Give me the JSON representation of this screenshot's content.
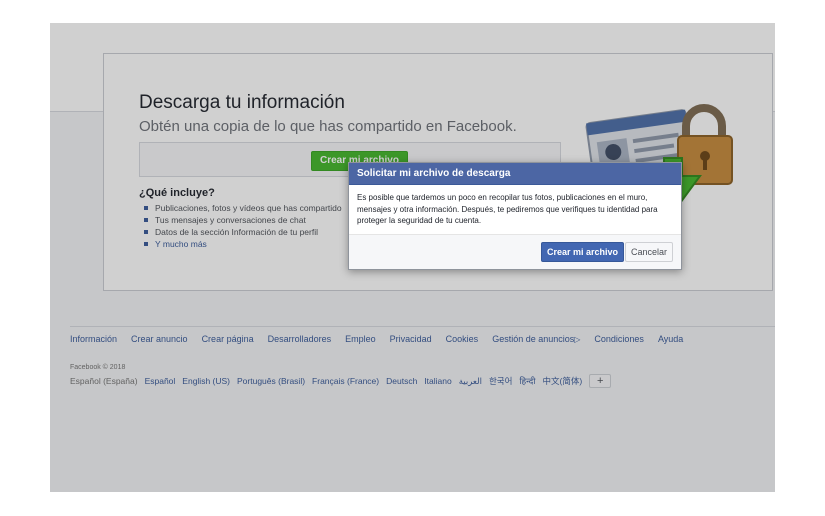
{
  "card": {
    "title": "Descarga tu información",
    "subtitle": "Obtén una copia de lo que has compartido en Facebook.",
    "create_button": "Crear mi archivo",
    "includes_heading": "¿Qué incluye?",
    "includes_items": [
      "Publicaciones, fotos y vídeos que has compartido",
      "Tus mensajes y conversaciones de chat",
      "Datos de la sección Información de tu perfil",
      "Y mucho más"
    ]
  },
  "illustration": {
    "icon": "profile-card-lock-download-icon",
    "colors": {
      "lock": "#c68a3a",
      "arrow": "#42b72a",
      "card": "#4b6ea8"
    }
  },
  "footer": {
    "links": [
      "Información",
      "Crear anuncio",
      "Crear página",
      "Desarrolladores",
      "Empleo",
      "Privacidad",
      "Cookies",
      "Gestión de anuncios",
      "Condiciones",
      "Ayuda"
    ],
    "copyright": "Facebook © 2018",
    "current_language": "Español (España)",
    "languages": [
      "Español",
      "English (US)",
      "Português (Brasil)",
      "Français (France)",
      "Deutsch",
      "Italiano",
      "العربية",
      "한국어",
      "हिन्दी",
      "中文(简体)"
    ],
    "more_languages": "+"
  },
  "modal": {
    "title": "Solicitar mi archivo de descarga",
    "body": "Es posible que tardemos un poco en recopilar tus fotos, publicaciones en el muro, mensajes y otra información. Después, te pediremos que verifiques tu identidad para proteger la seguridad de tu cuenta.",
    "confirm_button": "Crear mi archivo",
    "cancel_button": "Cancelar"
  },
  "colors": {
    "fb_blue": "#4267b2",
    "modal_header": "#4c66a4",
    "green": "#42b72a",
    "link": "#365899"
  }
}
